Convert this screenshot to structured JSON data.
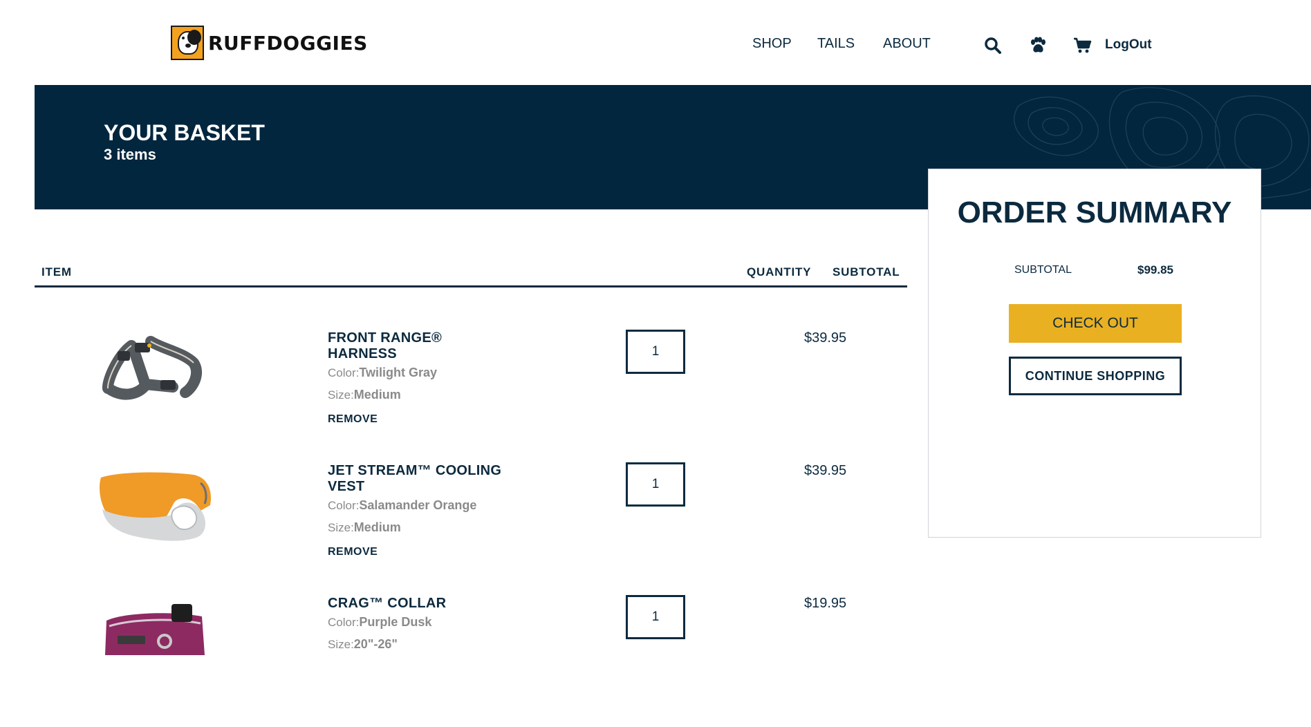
{
  "header": {
    "logo_text": "RUFFDOGGIES",
    "nav": [
      "SHOP",
      "TAILS",
      "ABOUT"
    ],
    "icons": [
      "search-icon",
      "paw-icon",
      "cart-icon"
    ],
    "logout_label": "LogOut"
  },
  "banner": {
    "title": "YOUR BASKET",
    "count": "3 items"
  },
  "table": {
    "headers": {
      "item": "ITEM",
      "quantity": "QUANTITY",
      "subtotal": "SUBTOTAL"
    },
    "color_label": "Color:",
    "size_label": "Size:",
    "remove_label": "REMOVE",
    "items": [
      {
        "name": "FRONT RANGE® HARNESS",
        "color": "Twilight Gray",
        "size": "Medium",
        "quantity": "1",
        "price": "$39.95"
      },
      {
        "name": "JET STREAM™ COOLING VEST",
        "color": "Salamander Orange",
        "size": "Medium",
        "quantity": "1",
        "price": "$39.95"
      },
      {
        "name": "CRAG™ COLLAR",
        "color": "Purple Dusk",
        "size": "20\"-26\"",
        "quantity": "1",
        "price": "$19.95"
      }
    ]
  },
  "summary": {
    "title": "ORDER SUMMARY",
    "subtotal_label": "SUBTOTAL",
    "subtotal_value": "$99.85",
    "checkout_label": "CHECK OUT",
    "continue_label": "CONTINUE SHOPPING"
  },
  "colors": {
    "navy": "#02263e",
    "text": "#0c2a3f",
    "checkout": "#e9b021",
    "logo_orange": "#f4a21e"
  }
}
